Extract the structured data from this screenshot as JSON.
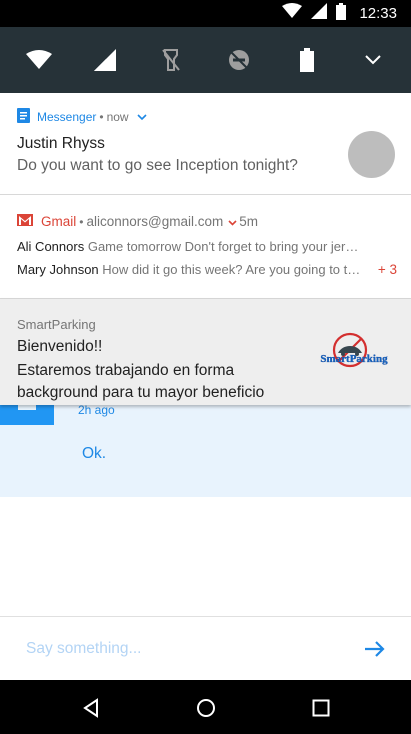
{
  "status_bar": {
    "time": "12:33",
    "icons": [
      "wifi-icon",
      "signal-icon",
      "battery-icon"
    ]
  },
  "quick_settings": {
    "tiles": [
      "wifi",
      "cellular-signal",
      "flashlight-off",
      "do-not-disturb",
      "battery",
      "expand"
    ]
  },
  "notifications": {
    "messenger": {
      "app": "Messenger",
      "time": "now",
      "sender": "Justin Rhyss",
      "text": "Do you want to go see Inception tonight?"
    },
    "gmail": {
      "app": "Gmail",
      "account": "aliconnors@gmail.com",
      "time": "5m",
      "lines": [
        {
          "sender": "Ali Connors",
          "text": "Game tomorrow Don't forget to bring your jersey"
        },
        {
          "sender": "Mary Johnson",
          "text": "How did it go this week? Are you going to the game"
        }
      ],
      "more": "+ 3"
    },
    "smartparking": {
      "app": "SmartParking",
      "title": "Bienvenido!!",
      "text": "Estaremos trabajando en forma background para tu mayor beneficio",
      "logo_text": "SmartParking"
    }
  },
  "chat": {
    "time": "2h ago",
    "message": "Ok.",
    "composer_placeholder": "Say something..."
  },
  "colors": {
    "accent": "#1e88e5",
    "gmail_red": "#db4437",
    "quick_settings_bg": "#263238"
  }
}
